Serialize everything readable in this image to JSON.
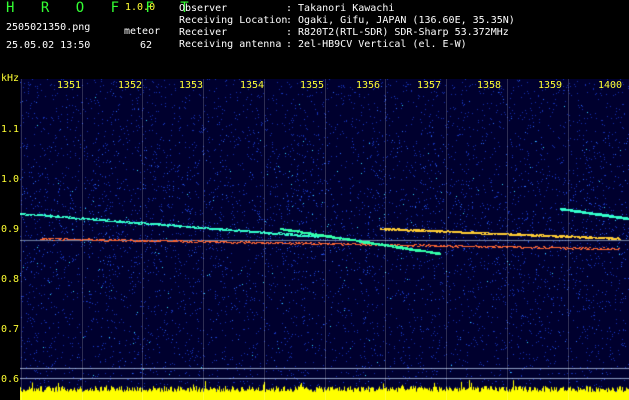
{
  "header": {
    "app_name": "H R O F F T",
    "version": "1.0.0",
    "filename": "2505021350.png",
    "datetime": "25.05.02 13:50",
    "meteor_label": "meteor",
    "meteor_count": "62"
  },
  "info": [
    {
      "label": "Observer",
      "value": ": Takanori Kawachi"
    },
    {
      "label": "Receiving Location",
      "value": ": Ogaki, Gifu, JAPAN (136.60E, 35.35N)"
    },
    {
      "label": "Receiver",
      "value": ": R820T2(RTL-SDR) SDR-Sharp 53.372MHz"
    },
    {
      "label": "Receiving antenna",
      "value": ": 2el-HB9CV Vertical (el. E-W)"
    }
  ],
  "axis": {
    "unit": "kHz",
    "x_ticks": [
      "1351",
      "1352",
      "1353",
      "1354",
      "1355",
      "1356",
      "1357",
      "1358",
      "1359",
      "1400"
    ],
    "y_ticks": [
      "1.1",
      "1.0",
      "0.9",
      "0.8",
      "0.7",
      "0.6"
    ]
  },
  "colors": {
    "background": "#000000",
    "header_green": "#33ff33",
    "axis_yellow": "#ffff33",
    "spectrogram_bg": "#00002e",
    "noise_blue": "#2a5cff",
    "signal_cyan": "#33ffcc",
    "signal_red": "#ff3333",
    "baseline_yellow": "#ffff00"
  }
}
